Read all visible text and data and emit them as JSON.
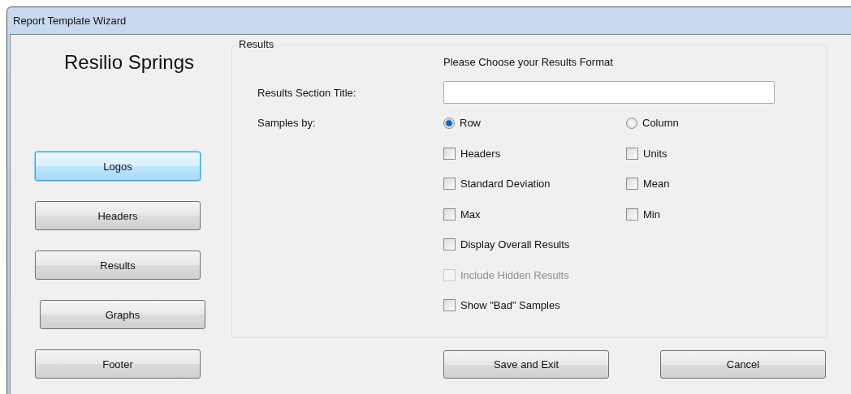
{
  "window": {
    "title": "Report Template Wizard"
  },
  "company_name": "Resilio Springs",
  "nav_buttons": [
    {
      "label": "Logos",
      "selected": true
    },
    {
      "label": "Headers",
      "selected": false
    },
    {
      "label": "Results",
      "selected": false
    },
    {
      "label": "Graphs",
      "selected": false
    },
    {
      "label": "Footer",
      "selected": false
    }
  ],
  "results_group": {
    "legend": "Results",
    "prompt": "Please Choose your Results Format",
    "section_title_label": "Results Section Title:",
    "samples_by_label": "Samples by:",
    "option_rows": [
      [
        {
          "kind": "radio",
          "label": "Row",
          "selected": true,
          "disabled": false
        },
        {
          "kind": "radio",
          "label": "Column",
          "selected": false,
          "disabled": false
        }
      ],
      [
        {
          "kind": "checkbox",
          "label": "Headers",
          "checked": false,
          "disabled": false
        },
        {
          "kind": "checkbox",
          "label": "Units",
          "checked": false,
          "disabled": false
        }
      ],
      [
        {
          "kind": "checkbox",
          "label": "Standard Deviation",
          "checked": false,
          "disabled": false
        },
        {
          "kind": "checkbox",
          "label": "Mean",
          "checked": false,
          "disabled": false
        }
      ],
      [
        {
          "kind": "checkbox",
          "label": "Max",
          "checked": false,
          "disabled": false
        },
        {
          "kind": "checkbox",
          "label": "Min",
          "checked": false,
          "disabled": false
        }
      ],
      [
        {
          "kind": "checkbox",
          "label": "Display Overall Results",
          "checked": false,
          "disabled": false
        }
      ],
      [
        {
          "kind": "checkbox",
          "label": "Include Hidden Results",
          "checked": false,
          "disabled": true
        }
      ],
      [
        {
          "kind": "checkbox",
          "label": "Show \"Bad\" Samples",
          "checked": false,
          "disabled": false
        }
      ]
    ]
  },
  "footer_buttons": [
    "Save and Exit",
    "Cancel"
  ]
}
